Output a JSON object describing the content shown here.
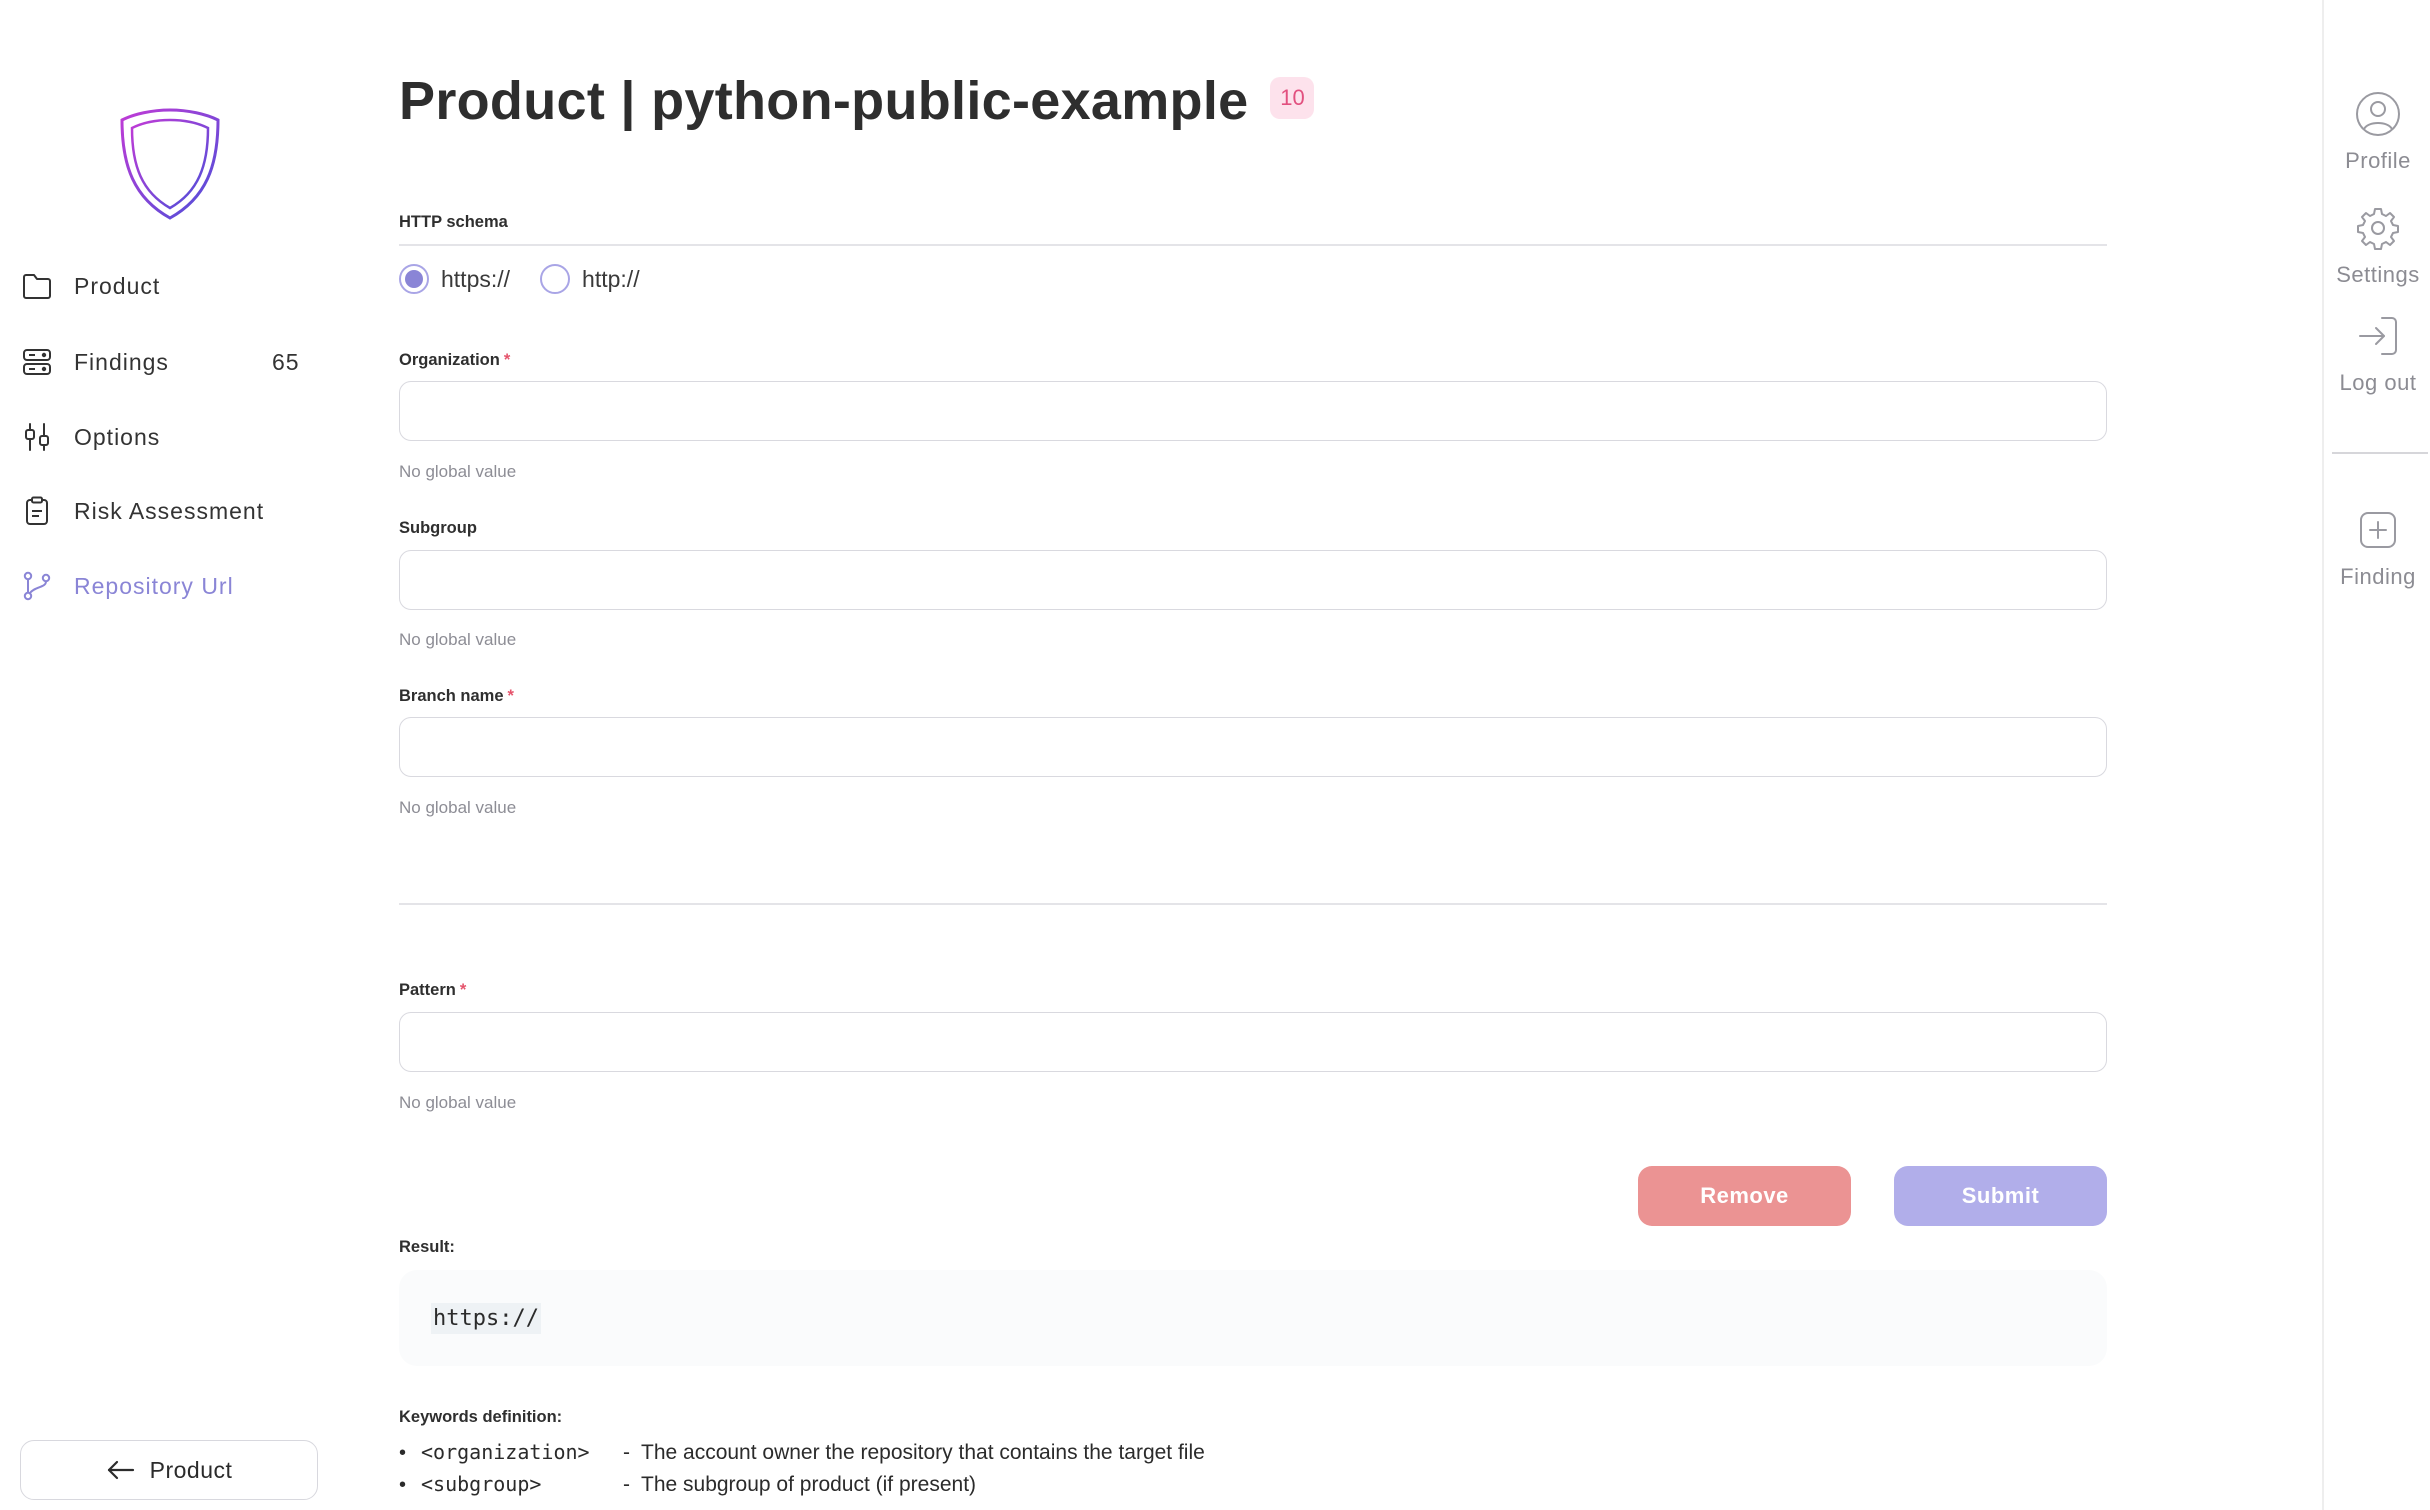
{
  "colors": {
    "accent": "#8a85d6",
    "danger": "#eb9393",
    "badge_bg": "#fde2ec",
    "badge_text": "#e2507f"
  },
  "sidebar": {
    "logo_icon": "shield-icon",
    "items": [
      {
        "label": "Product",
        "icon": "folder-icon"
      },
      {
        "label": "Findings",
        "icon": "server-icon",
        "count": "65"
      },
      {
        "label": "Options",
        "icon": "sliders-icon"
      },
      {
        "label": "Risk Assessment",
        "icon": "clipboard-icon"
      },
      {
        "label": "Repository Url",
        "icon": "git-branch-icon",
        "active": true
      }
    ],
    "back_button": {
      "label": "Product",
      "icon": "arrow-left-icon"
    }
  },
  "header": {
    "title": "Product | python-public-example",
    "count": "10"
  },
  "form": {
    "http_schema": {
      "label": "HTTP schema",
      "options": [
        {
          "label": "https://",
          "selected": true
        },
        {
          "label": "http://",
          "selected": false
        }
      ]
    },
    "organization": {
      "label": "Organization",
      "required": "*",
      "value": "",
      "hint": "No global value"
    },
    "subgroup": {
      "label": "Subgroup",
      "value": "",
      "hint": "No global value"
    },
    "branch_name": {
      "label": "Branch name",
      "required": "*",
      "value": "",
      "hint": "No global value"
    },
    "pattern": {
      "label": "Pattern",
      "required": "*",
      "value": "",
      "hint": "No global value"
    },
    "remove_label": "Remove",
    "submit_label": "Submit"
  },
  "result": {
    "label": "Result:",
    "value": "https://"
  },
  "keywords": {
    "label": "Keywords definition:",
    "items": [
      {
        "keyword": "<organization>",
        "separator": "-",
        "description": "The account owner the repository that contains the target file"
      },
      {
        "keyword": "<subgroup>",
        "separator": "-",
        "description": "The subgroup of product (if present)"
      }
    ]
  },
  "rail": {
    "items": [
      {
        "label": "Profile",
        "icon": "user-circle-icon"
      },
      {
        "label": "Settings",
        "icon": "gear-icon"
      },
      {
        "label": "Log out",
        "icon": "log-in-icon"
      },
      {
        "label": "Finding",
        "icon": "plus-square-icon"
      }
    ]
  }
}
